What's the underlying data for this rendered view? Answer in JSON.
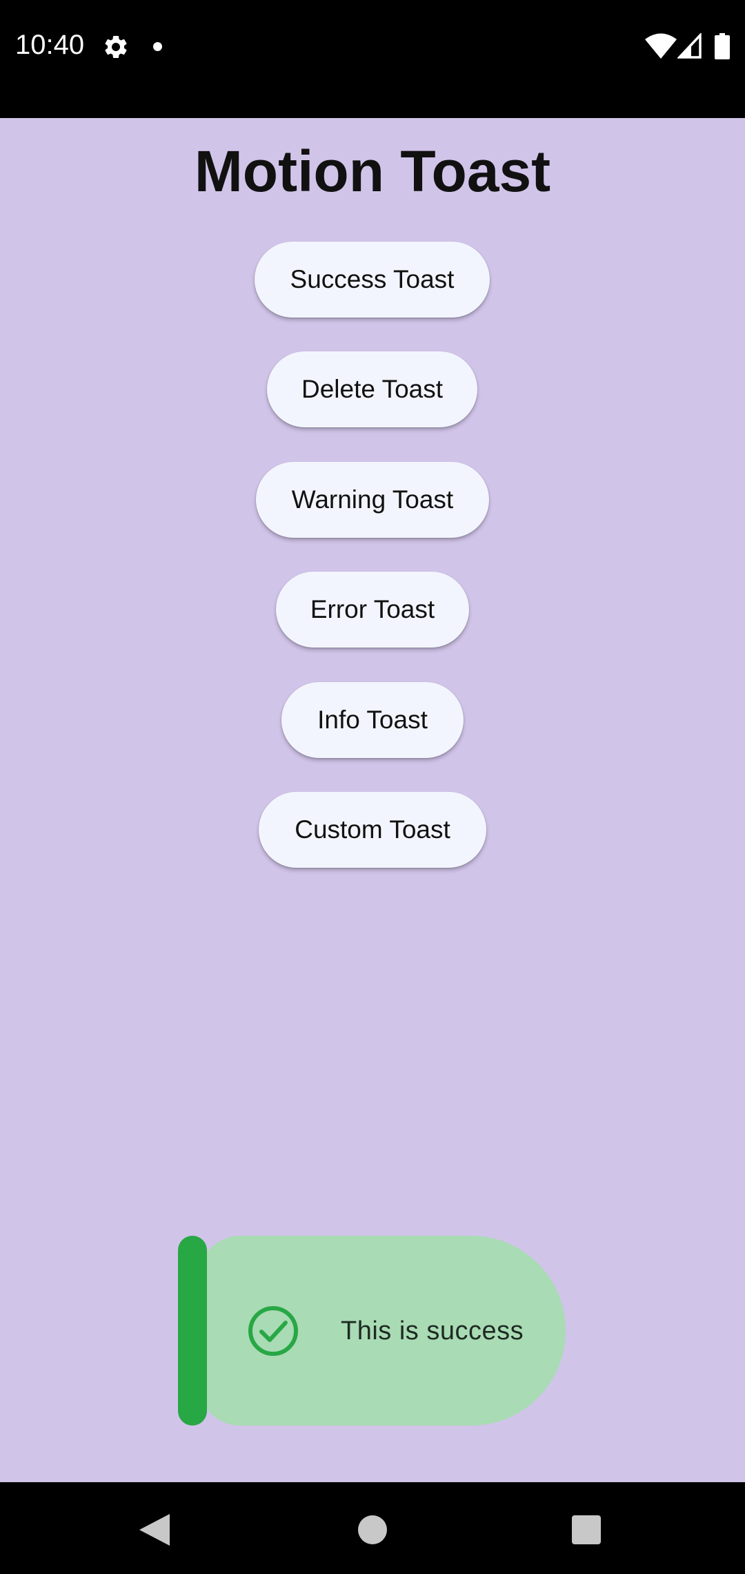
{
  "status_bar": {
    "time": "10:40",
    "icons": [
      "gear-icon",
      "notification-dot-icon",
      "wifi-icon",
      "signal-icon",
      "battery-icon"
    ]
  },
  "main": {
    "title": "Motion Toast",
    "buttons": [
      {
        "label": "Success Toast"
      },
      {
        "label": "Delete Toast"
      },
      {
        "label": "Warning Toast"
      },
      {
        "label": "Error Toast"
      },
      {
        "label": "Info Toast"
      },
      {
        "label": "Custom Toast"
      }
    ]
  },
  "toast": {
    "message": "This is success",
    "icon": "check-circle-icon",
    "accent_color": "#28a745",
    "background_color": "#a9dbb4"
  },
  "nav_bar": {
    "icons": [
      "back-icon",
      "home-icon",
      "recents-icon"
    ]
  },
  "colors": {
    "page_background": "#d1c4e9",
    "button_background": "#f2f5fd",
    "system_bars": "#000000"
  }
}
